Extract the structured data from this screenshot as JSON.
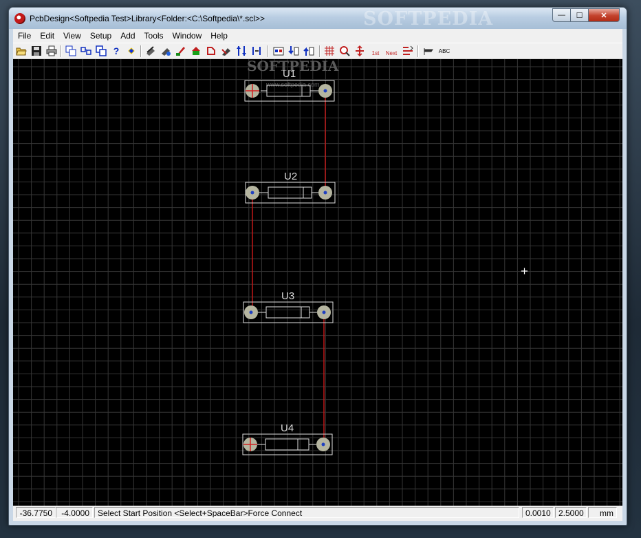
{
  "window": {
    "title": "PcbDesign<Softpedia Test>Library<Folder:<C:\\Softpedia\\*.scl>>",
    "title_watermark": "SOFTPEDIA",
    "buttons": {
      "minimize": "—",
      "maximize": "☐",
      "close": "✕"
    }
  },
  "menu": [
    "File",
    "Edit",
    "View",
    "Setup",
    "Add",
    "Tools",
    "Window",
    "Help"
  ],
  "toolbar": {
    "buttons": [
      {
        "name": "open-icon"
      },
      {
        "name": "save-icon"
      },
      {
        "name": "print-icon"
      },
      {
        "name": "copy-icon"
      },
      {
        "name": "paste-icon"
      },
      {
        "name": "duplicate-icon"
      },
      {
        "name": "help-icon",
        "glyph": "?"
      },
      {
        "name": "diamond-icon"
      },
      {
        "name": "route-icon"
      },
      {
        "name": "unroute-icon"
      },
      {
        "name": "pen-icon"
      },
      {
        "name": "drc-icon"
      },
      {
        "name": "rotate-icon"
      },
      {
        "name": "flip-icon"
      },
      {
        "name": "swap-icon"
      },
      {
        "name": "mirror-icon"
      },
      {
        "name": "netlist-icon"
      },
      {
        "name": "import-icon"
      },
      {
        "name": "export-icon"
      },
      {
        "name": "grid-icon"
      },
      {
        "name": "zoom-icon"
      },
      {
        "name": "measure-icon"
      },
      {
        "name": "check-1st-icon",
        "glyph": "1st"
      },
      {
        "name": "check-next-icon",
        "glyph": "Next"
      },
      {
        "name": "clear-icon"
      },
      {
        "name": "tag-icon"
      },
      {
        "name": "text-tool-icon",
        "glyph": "ABC"
      }
    ]
  },
  "canvas": {
    "watermark": "SOFTPEDIA",
    "watermark_url": "www.softpedia.com",
    "components": [
      {
        "label": "U1"
      },
      {
        "label": "U2"
      },
      {
        "label": "U3"
      },
      {
        "label": "U4"
      }
    ]
  },
  "status": {
    "x": "-36.7750",
    "y": "-4.0000",
    "message": "Select Start Position <Select+SpaceBar>Force Connect",
    "resolution": "0.0010",
    "grid": "2.5000",
    "units": "mm"
  },
  "colors": {
    "canvas_bg": "#000000",
    "grid": "#3a3a3a",
    "trace": "#c01818",
    "pad": "#b5b5a0",
    "outline": "#e0e0e0"
  }
}
